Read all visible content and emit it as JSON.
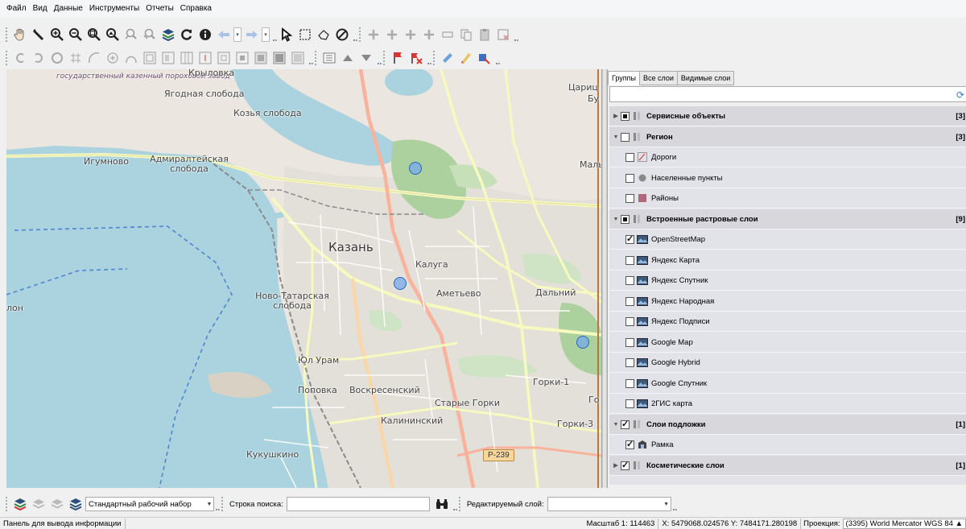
{
  "menu": [
    "Файл",
    "Вид",
    "Данные",
    "Инструменты",
    "Отчеты",
    "Справка"
  ],
  "toolbar1": {
    "icons": [
      "pan-hand-icon",
      "measure-ruler-icon",
      "zoom-in-icon",
      "zoom-out-icon",
      "zoom-extent-icon",
      "zoom-selection-icon",
      "zoom-prev-icon",
      "zoom-next-icon",
      "layers-icon",
      "refresh-icon",
      "info-icon",
      "back-arrow-icon",
      "forward-arrow-icon",
      "select-arrow-icon",
      "select-rect-icon",
      "select-poly-icon",
      "clear-selection-icon",
      "add-point-icon",
      "add-line-icon",
      "add-polygon-icon",
      "add-object-icon",
      "edit-object-icon",
      "copy-object-icon",
      "paste-object-icon",
      "delete-object-icon"
    ]
  },
  "map": {
    "labels": {
      "factory": "государственный казенный пороховой завод",
      "krylovka": "Крыловка",
      "yagodnaya": "Ягодная слобода",
      "kozya": "Козья слобода",
      "igumnovo": "Игумново",
      "admiralteyskaya": "Адмиралтейская слобода",
      "kazan": "Казань",
      "kaluga": "Калуга",
      "ametyevo": "Аметьево",
      "dalniy": "Дальний",
      "novotatarskaya": "Ново-Татарская слобода",
      "yul_uram": "Юл Урам",
      "popovka": "Поповка",
      "voskresenskiy": "Воскресенский",
      "gorki1": "Горки-1",
      "starye_gorki": "Старые Горки",
      "kalininskiy": "Калининский",
      "gorki3": "Горки-3",
      "kukushkino": "Кукушкино",
      "road": "Р-239",
      "edge_left": "лон",
      "edge_right_top": "Цариц",
      "edge_right_top2": "Бу",
      "edge_right_mid": "Маль",
      "edge_right_bottom": "Го"
    }
  },
  "panel": {
    "tabs": [
      "Группы",
      "Все слои",
      "Видимые слои"
    ],
    "active_tab": 0,
    "search_value": "",
    "rows": [
      {
        "type": "group",
        "label": "Сервисные объекты",
        "count": "[3]",
        "expanded": false,
        "state": "partial"
      },
      {
        "type": "group",
        "label": "Регион",
        "count": "[3]",
        "expanded": true,
        "state": "unchecked"
      },
      {
        "type": "layer",
        "label": "Дороги",
        "icon": "line-layer-icon",
        "state": "unchecked"
      },
      {
        "type": "layer",
        "label": "Населенные пункты",
        "icon": "point-layer-icon",
        "state": "unchecked"
      },
      {
        "type": "layer",
        "label": "Районы",
        "icon": "polygon-layer-icon",
        "state": "unchecked"
      },
      {
        "type": "group",
        "label": "Встроенные растровые слои",
        "count": "[9]",
        "expanded": true,
        "state": "partial"
      },
      {
        "type": "layer",
        "label": "OpenStreetMap",
        "icon": "raster-layer-icon",
        "state": "checked"
      },
      {
        "type": "layer",
        "label": "Яндекс Карта",
        "icon": "raster-layer-icon",
        "state": "unchecked"
      },
      {
        "type": "layer",
        "label": "Яндекс Спутник",
        "icon": "raster-layer-icon",
        "state": "unchecked"
      },
      {
        "type": "layer",
        "label": "Яндекс Народная",
        "icon": "raster-layer-icon",
        "state": "unchecked"
      },
      {
        "type": "layer",
        "label": "Яндекс Подписи",
        "icon": "raster-layer-icon",
        "state": "unchecked"
      },
      {
        "type": "layer",
        "label": "Google Map",
        "icon": "raster-layer-icon",
        "state": "unchecked"
      },
      {
        "type": "layer",
        "label": "Google Hybrid",
        "icon": "raster-layer-icon",
        "state": "unchecked"
      },
      {
        "type": "layer",
        "label": "Google Спутник",
        "icon": "raster-layer-icon",
        "state": "unchecked"
      },
      {
        "type": "layer",
        "label": "2ГИС карта",
        "icon": "raster-layer-icon",
        "state": "unchecked"
      },
      {
        "type": "group",
        "label": "Слои подложки",
        "count": "[1]",
        "expanded": true,
        "state": "checked"
      },
      {
        "type": "layer",
        "label": "Рамка",
        "icon": "frame-layer-icon",
        "state": "checked"
      },
      {
        "type": "group",
        "label": "Косметические слои",
        "count": "[1]",
        "expanded": false,
        "state": "checked"
      }
    ]
  },
  "bottombar": {
    "workset_value": "Стандартный рабочий набор",
    "search_label": "Строка поиска:",
    "search_value": "",
    "edit_layer_label": "Редактируемый слой:",
    "edit_layer_value": ""
  },
  "status": {
    "output_panel": "Панель для вывода информации",
    "scale": "Масштаб 1: 114463",
    "coords": "X: 5479068.024576  Y: 7484171.280198",
    "projection_label": "Проекция:",
    "projection_value": "(3395) World Mercator WGS 84"
  },
  "colors": {
    "water": "#aad3df",
    "park": "#add19e",
    "road_major": "#f7fabf",
    "road_trunk": "#f9b29c",
    "poi": "#76aaeb"
  }
}
